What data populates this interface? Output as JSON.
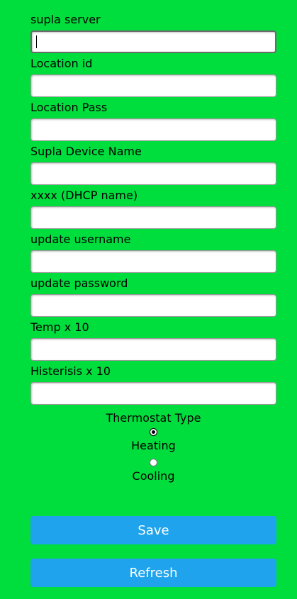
{
  "form": {
    "fields": [
      {
        "label": "supla server",
        "value": ""
      },
      {
        "label": "Location id",
        "value": ""
      },
      {
        "label": "Location Pass",
        "value": ""
      },
      {
        "label": "Supla Device Name",
        "value": ""
      },
      {
        "label": "xxxx (DHCP name)",
        "value": ""
      },
      {
        "label": "update username",
        "value": ""
      },
      {
        "label": "update password",
        "value": ""
      },
      {
        "label": "Temp x 10",
        "value": ""
      },
      {
        "label": "Histerisis x 10",
        "value": ""
      }
    ]
  },
  "thermostat": {
    "title": "Thermostat Type",
    "options": [
      {
        "label": "Heating",
        "selected": true
      },
      {
        "label": "Cooling",
        "selected": false
      }
    ]
  },
  "buttons": {
    "save": "Save",
    "refresh": "Refresh"
  },
  "colors": {
    "background": "#00de3e",
    "button": "#1fa3ec"
  }
}
